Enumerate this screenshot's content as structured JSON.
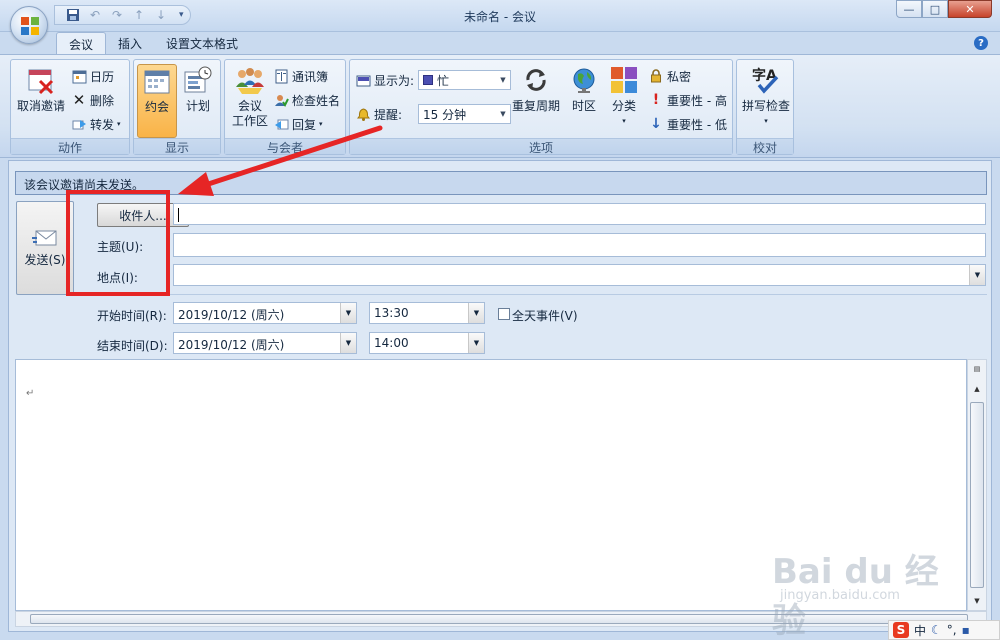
{
  "window": {
    "title": "未命名 - 会议"
  },
  "tabs": [
    {
      "label": "会议"
    },
    {
      "label": "插入"
    },
    {
      "label": "设置文本格式"
    }
  ],
  "ribbon": {
    "actions": {
      "group_label": "动作",
      "cancel_invitation": "取消邀请",
      "calendar": "日历",
      "delete": "删除",
      "forward": "转发"
    },
    "show": {
      "group_label": "显示",
      "appointment": "约会",
      "scheduling": "计划"
    },
    "attendees": {
      "group_label": "与会者",
      "meeting_workspace_line1": "会议",
      "meeting_workspace_line2": "工作区",
      "address_book": "通讯簿",
      "check_names": "检查姓名",
      "reply": "回复"
    },
    "options": {
      "group_label": "选项",
      "show_as_label": "显示为:",
      "show_as_value": "忙",
      "reminder_label": "提醒:",
      "reminder_value": "15 分钟",
      "recurrence": "重复周期",
      "time_zones": "时区",
      "categorize": "分类",
      "private": "私密",
      "high_importance": "重要性 - 高",
      "low_importance": "重要性 - 低"
    },
    "proofing": {
      "group_label": "校对",
      "spelling": "拼写检查"
    }
  },
  "form": {
    "info_message": "该会议邀请尚未发送。",
    "send": "发送(S)",
    "to_button": "收件人...",
    "to_value": "",
    "subject_label": "主题(U):",
    "subject_value": "",
    "location_label": "地点(I):",
    "location_value": "",
    "start_label": "开始时间(R):",
    "start_date": "2019/10/12 (周六)",
    "start_time": "13:30",
    "end_label": "结束时间(D):",
    "end_date": "2019/10/12 (周六)",
    "end_time": "14:00",
    "all_day_label": "全天事件(V)",
    "all_day_checked": false
  },
  "body": {
    "paragraph_mark": "↵"
  },
  "watermark": {
    "main": "Bai du 经验",
    "sub": "jingyan.baidu.com"
  },
  "ime": {
    "s": "S",
    "lang": "中"
  },
  "colors": {
    "highlight_box": "#e62525",
    "arrow": "#e62525",
    "pressed_button": "#f9b347"
  }
}
